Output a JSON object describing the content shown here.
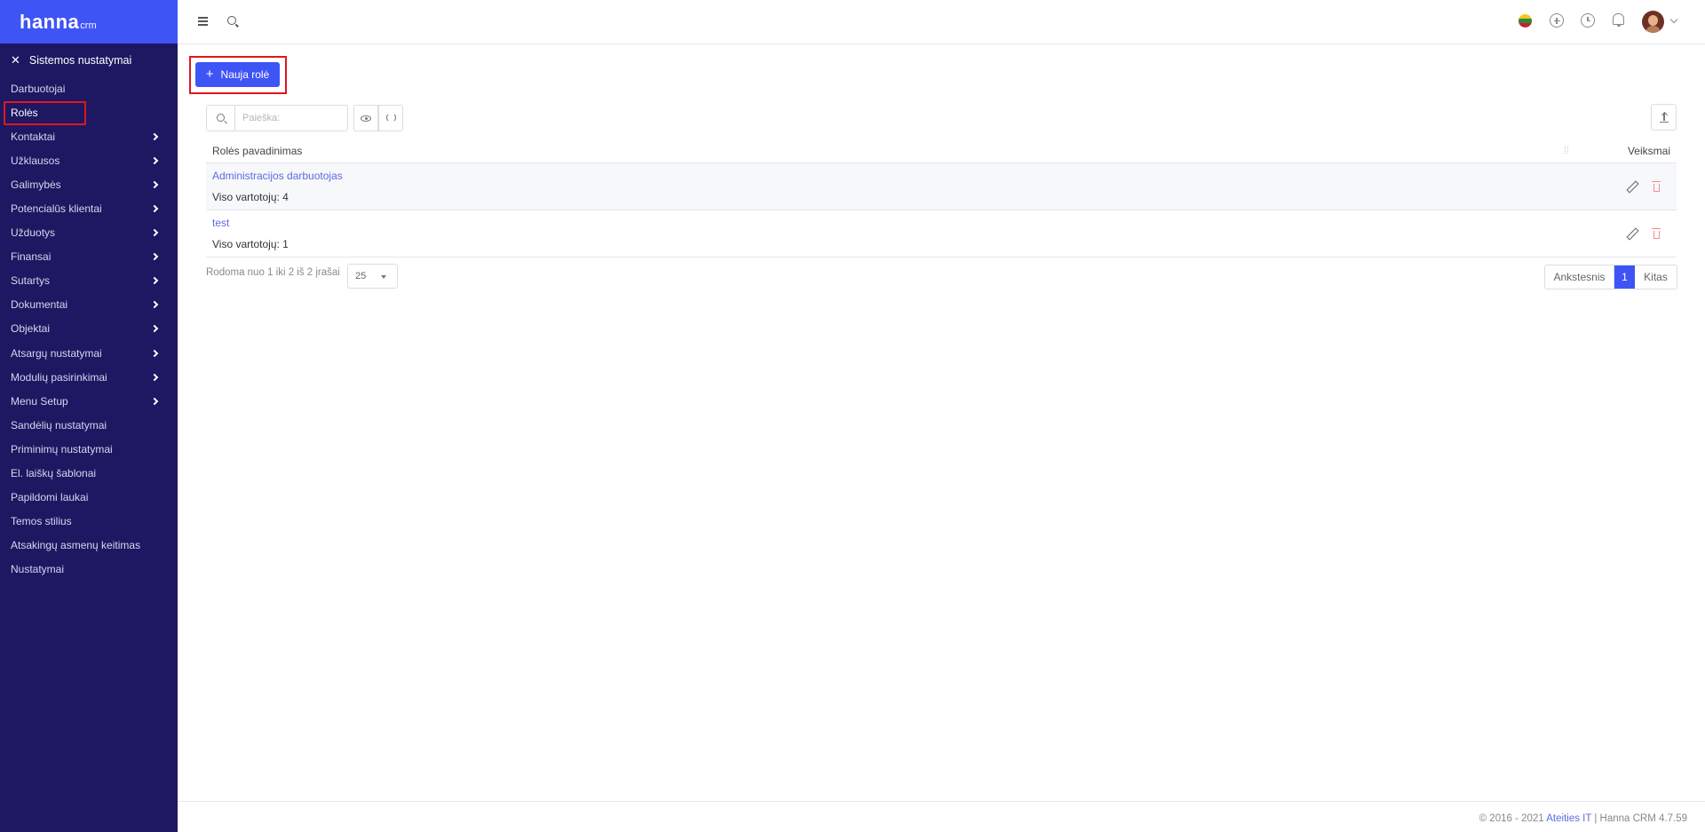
{
  "brand": {
    "name": "hanna",
    "suffix": "crm"
  },
  "sidebar": {
    "section_title": "Sistemos nustatymai",
    "items": [
      {
        "label": "Darbuotojai",
        "has_children": false,
        "active": false
      },
      {
        "label": "Rolės",
        "has_children": false,
        "active": true
      },
      {
        "label": "Kontaktai",
        "has_children": true,
        "active": false
      },
      {
        "label": "Užklausos",
        "has_children": true,
        "active": false
      },
      {
        "label": "Galimybės",
        "has_children": true,
        "active": false
      },
      {
        "label": "Potencialūs klientai",
        "has_children": true,
        "active": false
      },
      {
        "label": "Užduotys",
        "has_children": true,
        "active": false
      },
      {
        "label": "Finansai",
        "has_children": true,
        "active": false
      },
      {
        "label": "Sutartys",
        "has_children": true,
        "active": false
      },
      {
        "label": "Dokumentai",
        "has_children": true,
        "active": false
      },
      {
        "label": "Objektai",
        "has_children": true,
        "active": false
      },
      {
        "label": "Atsargų nustatymai",
        "has_children": true,
        "active": false
      },
      {
        "label": "Modulių pasirinkimai",
        "has_children": true,
        "active": false
      },
      {
        "label": "Menu Setup",
        "has_children": true,
        "active": false
      },
      {
        "label": "Sandėlių nustatymai",
        "has_children": false,
        "active": false
      },
      {
        "label": "Priminimų nustatymai",
        "has_children": false,
        "active": false
      },
      {
        "label": "El. laiškų šablonai",
        "has_children": false,
        "active": false
      },
      {
        "label": "Papildomi laukai",
        "has_children": false,
        "active": false
      },
      {
        "label": "Temos stilius",
        "has_children": false,
        "active": false
      },
      {
        "label": "Atsakingų asmenų keitimas",
        "has_children": false,
        "active": false
      },
      {
        "label": "Nustatymai",
        "has_children": false,
        "active": false
      }
    ]
  },
  "topbar": {
    "icons": [
      "menu-icon",
      "search-icon",
      "language-flag-icon",
      "plus-circle-icon",
      "clock-icon",
      "bell-icon",
      "avatar"
    ]
  },
  "toolbar": {
    "new_role_label": "Nauja rolė",
    "search_placeholder": "Paieška:"
  },
  "table": {
    "columns": [
      "Rolės pavadinimas",
      "Veiksmai"
    ],
    "rows": [
      {
        "name": "Administracijos darbuotojas",
        "meta": "Viso vartotojų: 4"
      },
      {
        "name": "test",
        "meta": "Viso vartotojų: 1"
      }
    ]
  },
  "pagination": {
    "info": "Rodoma nuo 1 iki 2 iš 2 įrašai",
    "per_page": "25",
    "prev_label": "Ankstesnis",
    "current_page": "1",
    "next_label": "Kitas"
  },
  "footer": {
    "prefix": "© 2016 - 2021 ",
    "company": "Ateities IT",
    "suffix": " | Hanna CRM 4.7.59"
  },
  "colors": {
    "sidebar_bg": "#1e1762",
    "brand_bg": "#3f54f5",
    "primary": "#3f54f5",
    "link": "#5b6be0",
    "highlight_frame": "#e0161e",
    "delete": "#f28b93"
  }
}
